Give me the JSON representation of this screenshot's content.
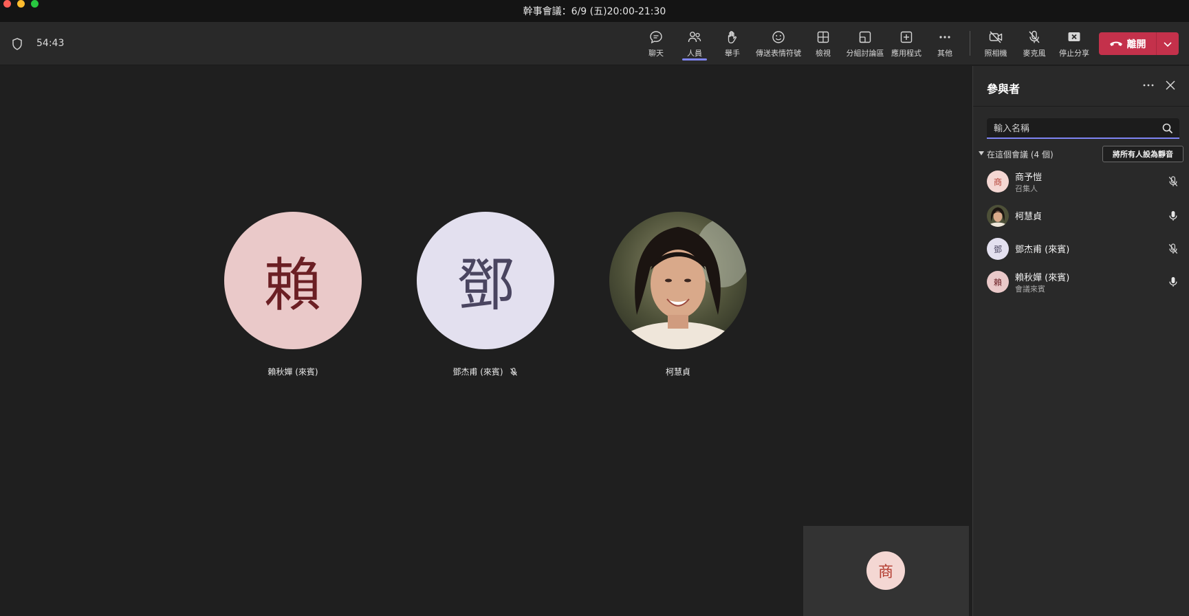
{
  "window": {
    "title": "幹事會議：6/9 (五)20:00-21:30"
  },
  "toolbar": {
    "timer": "54:43",
    "tools": [
      {
        "id": "chat",
        "label": "聊天",
        "icon": "chat-icon"
      },
      {
        "id": "people",
        "label": "人員",
        "icon": "people-icon",
        "active": true
      },
      {
        "id": "raise",
        "label": "舉手",
        "icon": "hand-icon"
      },
      {
        "id": "react",
        "label": "傳送表情符號",
        "icon": "emoji-icon"
      },
      {
        "id": "view",
        "label": "檢視",
        "icon": "grid-icon"
      },
      {
        "id": "rooms",
        "label": "分組討論區",
        "icon": "breakout-icon"
      },
      {
        "id": "apps",
        "label": "應用程式",
        "icon": "add-app-icon"
      },
      {
        "id": "more",
        "label": "其他",
        "icon": "more-icon"
      },
      {
        "id": "camera",
        "label": "照相機",
        "icon": "camera-off-icon"
      },
      {
        "id": "mic",
        "label": "麥克風",
        "icon": "mic-off-icon"
      },
      {
        "id": "share",
        "label": "停止分享",
        "icon": "stop-share-icon"
      }
    ],
    "leave_label": "離開"
  },
  "stage": {
    "tiles": [
      {
        "initial": "賴",
        "name": "賴秋嬋 (來賓)",
        "bg": "#eac9c9",
        "fg": "#6b1f24",
        "muted": false
      },
      {
        "initial": "鄧",
        "name": "鄧杰甫 (來賓)",
        "bg": "#e3e0ef",
        "fg": "#4a4560",
        "muted": true
      },
      {
        "initial": "",
        "name": "柯慧貞",
        "photo": true,
        "muted": false
      }
    ],
    "self_initial": "商"
  },
  "panel": {
    "title": "參與者",
    "search_placeholder": "輸入名稱",
    "section_label": "在這個會議 (4 個)",
    "mute_all_label": "將所有人設為靜音",
    "participants": [
      {
        "initial": "商",
        "name": "商予愷",
        "role": "召集人",
        "bg": "#f4d7d3",
        "fg": "#b23a2e",
        "mic": "off"
      },
      {
        "initial": "",
        "name": "柯慧貞",
        "role": "",
        "photo": true,
        "mic": "on"
      },
      {
        "initial": "鄧",
        "name": "鄧杰甫 (來賓)",
        "role": "",
        "bg": "#e3e0ef",
        "fg": "#4a4560",
        "mic": "off"
      },
      {
        "initial": "賴",
        "name": "賴秋嬋 (來賓)",
        "role": "會議來賓",
        "bg": "#eac9c9",
        "fg": "#6b1f24",
        "mic": "on"
      }
    ]
  }
}
